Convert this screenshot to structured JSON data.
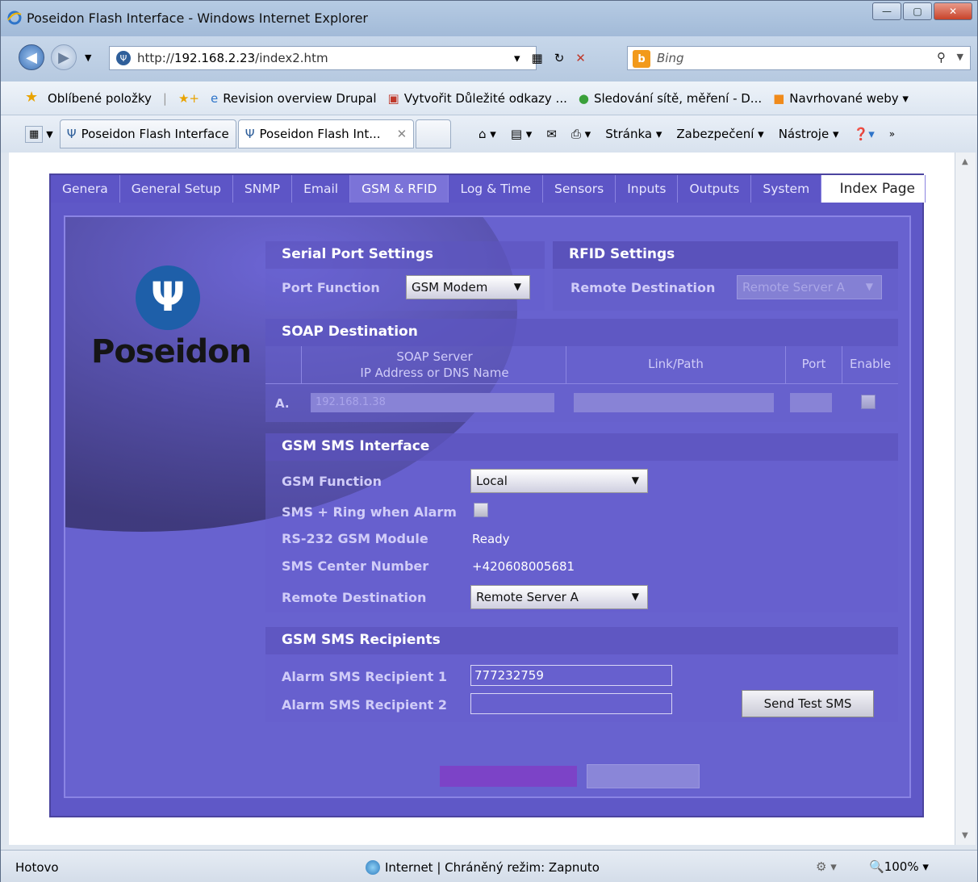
{
  "window": {
    "title": "Poseidon Flash Interface - Windows Internet Explorer"
  },
  "address": {
    "url_prefix": "http://",
    "url_host": "192.168.2.23",
    "url_path": "/index2.htm",
    "search_placeholder": "Bing"
  },
  "favorites": {
    "label": "Oblíbené položky",
    "items": [
      "Revision overview Drupal",
      "Vytvořit Důležité odkazy ...",
      "Sledování sítě, měření - D...",
      "Navrhované weby ▾"
    ]
  },
  "browser_tabs": [
    {
      "label": "Poseidon Flash Interface"
    },
    {
      "label": "Poseidon Flash Int..."
    }
  ],
  "command_bar": {
    "page": "Stránka ▾",
    "security": "Zabezpečení ▾",
    "tools": "Nástroje ▾"
  },
  "status": {
    "left": "Hotovo",
    "zone": "Internet | Chráněný režim: Zapnuto",
    "zoom": "100%"
  },
  "app": {
    "tabs": [
      "Genera",
      "General Setup",
      "SNMP",
      "Email",
      "GSM & RFID",
      "Log & Time",
      "Sensors",
      "Inputs",
      "Outputs",
      "System"
    ],
    "active_tab": "GSM & RFID",
    "index_page": "Index Page",
    "logo_text": "Poseidon",
    "serial": {
      "title": "Serial Port Settings",
      "port_function_label": "Port Function",
      "port_function_value": "GSM Modem"
    },
    "rfid": {
      "title": "RFID Settings",
      "remote_destination_label": "Remote Destination",
      "remote_destination_value": "Remote Server A"
    },
    "soap": {
      "title": "SOAP Destination",
      "col_server_1": "SOAP Server",
      "col_server_2": "IP Address or DNS Name",
      "col_link": "Link/Path",
      "col_port": "Port",
      "col_enable": "Enable",
      "row_label": "A.",
      "server_value": "192.168.1.38"
    },
    "gsm": {
      "title": "GSM SMS Interface",
      "function_label": "GSM Function",
      "function_value": "Local",
      "ring_label": "SMS + Ring when Alarm",
      "module_label": "RS-232 GSM Module",
      "module_value": "Ready",
      "center_label": "SMS Center Number",
      "center_value": "+420608005681",
      "remote_label": "Remote Destination",
      "remote_value": "Remote Server A"
    },
    "recipients": {
      "title": "GSM SMS Recipients",
      "r1_label": "Alarm SMS Recipient 1",
      "r1_value": "777232759",
      "r2_label": "Alarm SMS Recipient 2",
      "r2_value": "",
      "test_button": "Send Test SMS"
    }
  }
}
